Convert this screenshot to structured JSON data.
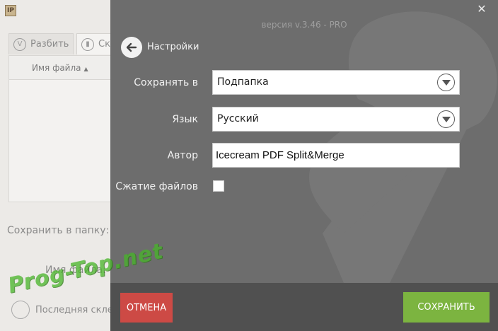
{
  "background_app": {
    "tabs": [
      {
        "label": "Разбить"
      },
      {
        "label": "Скл"
      }
    ],
    "table": {
      "column_header": "Имя файла"
    },
    "save_to_folder_label": "Сохранить в папку:",
    "file_name_label": "Имя файла:",
    "last_split_label": "Последняя склей"
  },
  "settings": {
    "version": "версия v.3.46 - PRO",
    "title": "Настройки",
    "fields": {
      "save_in": {
        "label": "Сохранять в",
        "value": "Подпапка"
      },
      "language": {
        "label": "Язык",
        "value": "Русский"
      },
      "author": {
        "label": "Автор",
        "value": "Icecream PDF Split&Merge"
      },
      "compress": {
        "label": "Сжатие файлов",
        "checked": false
      }
    },
    "buttons": {
      "cancel": "ОТМЕНА",
      "save": "СОХРАНИТЬ"
    }
  },
  "watermark": "Prog-Top.net",
  "icons": {
    "close": "close-icon",
    "back": "arrow-left-icon",
    "dropdown": "chevron-down-icon"
  },
  "colors": {
    "overlay": "#6d6d6d",
    "footer": "#505050",
    "cancel": "#cd4a45",
    "save": "#7cb440"
  }
}
